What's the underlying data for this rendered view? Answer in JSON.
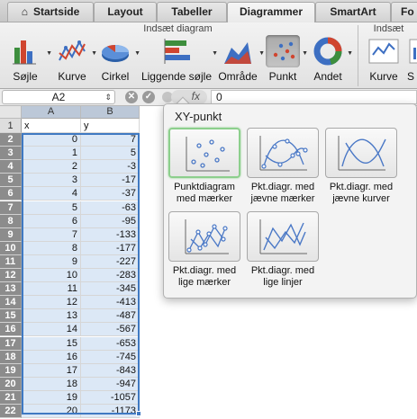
{
  "ribbon": {
    "tabs": [
      {
        "label": "Startside",
        "active": false,
        "home_glyph": "⌂"
      },
      {
        "label": "Layout",
        "active": false
      },
      {
        "label": "Tabeller",
        "active": false
      },
      {
        "label": "Diagrammer",
        "active": true
      },
      {
        "label": "SmartArt",
        "active": false
      },
      {
        "label": "Fo",
        "active": false
      }
    ],
    "group_insert_chart": "Indsæt diagram",
    "group_insert_sparkline": "Indsæt",
    "buttons": {
      "column": "Søjle",
      "line": "Kurve",
      "pie": "Cirkel",
      "bar": "Liggende søjle",
      "area": "Område",
      "scatter": "Punkt",
      "other": "Andet",
      "sparkline_line": "Kurve",
      "sparkline_column": "S"
    }
  },
  "formula_bar": {
    "name_box": "A2",
    "fx_label": "fx",
    "value": "0"
  },
  "sheet": {
    "columns": [
      "A",
      "B"
    ],
    "header_row": {
      "a": "x",
      "b": "y"
    },
    "rows": [
      {
        "row": "2",
        "x": "0",
        "y": "7"
      },
      {
        "row": "3",
        "x": "1",
        "y": "5"
      },
      {
        "row": "4",
        "x": "2",
        "y": "-3"
      },
      {
        "row": "5",
        "x": "3",
        "y": "-17"
      },
      {
        "row": "6",
        "x": "4",
        "y": "-37"
      },
      {
        "row": "7",
        "x": "5",
        "y": "-63"
      },
      {
        "row": "8",
        "x": "6",
        "y": "-95"
      },
      {
        "row": "9",
        "x": "7",
        "y": "-133"
      },
      {
        "row": "10",
        "x": "8",
        "y": "-177"
      },
      {
        "row": "11",
        "x": "9",
        "y": "-227"
      },
      {
        "row": "12",
        "x": "10",
        "y": "-283"
      },
      {
        "row": "13",
        "x": "11",
        "y": "-345"
      },
      {
        "row": "14",
        "x": "12",
        "y": "-413"
      },
      {
        "row": "15",
        "x": "13",
        "y": "-487"
      },
      {
        "row": "16",
        "x": "14",
        "y": "-567"
      },
      {
        "row": "17",
        "x": "15",
        "y": "-653"
      },
      {
        "row": "18",
        "x": "16",
        "y": "-745"
      },
      {
        "row": "19",
        "x": "17",
        "y": "-843"
      },
      {
        "row": "20",
        "x": "18",
        "y": "-947"
      },
      {
        "row": "21",
        "x": "19",
        "y": "-1057"
      },
      {
        "row": "22",
        "x": "20",
        "y": "-1173"
      }
    ]
  },
  "popup": {
    "title": "XY-punkt",
    "options": [
      {
        "line1": "Punktdiagram",
        "line2": "med mærker",
        "icon": "scatter-markers-icon",
        "selected": true
      },
      {
        "line1": "Pkt.diagr. med",
        "line2": "jævne mærker",
        "icon": "scatter-smooth-markers-icon",
        "selected": false
      },
      {
        "line1": "Pkt.diagr. med",
        "line2": "jævne kurver",
        "icon": "scatter-smooth-lines-icon",
        "selected": false
      },
      {
        "line1": "Pkt.diagr. med",
        "line2": "lige mærker",
        "icon": "scatter-straight-markers-icon",
        "selected": false
      },
      {
        "line1": "Pkt.diagr. med",
        "line2": "lige linjer",
        "icon": "scatter-straight-lines-icon",
        "selected": false
      }
    ]
  },
  "colors": {
    "accent": "#3f79c2",
    "selection_fill": "#dce8f6",
    "selected_option_border": "#8ccf8c"
  }
}
